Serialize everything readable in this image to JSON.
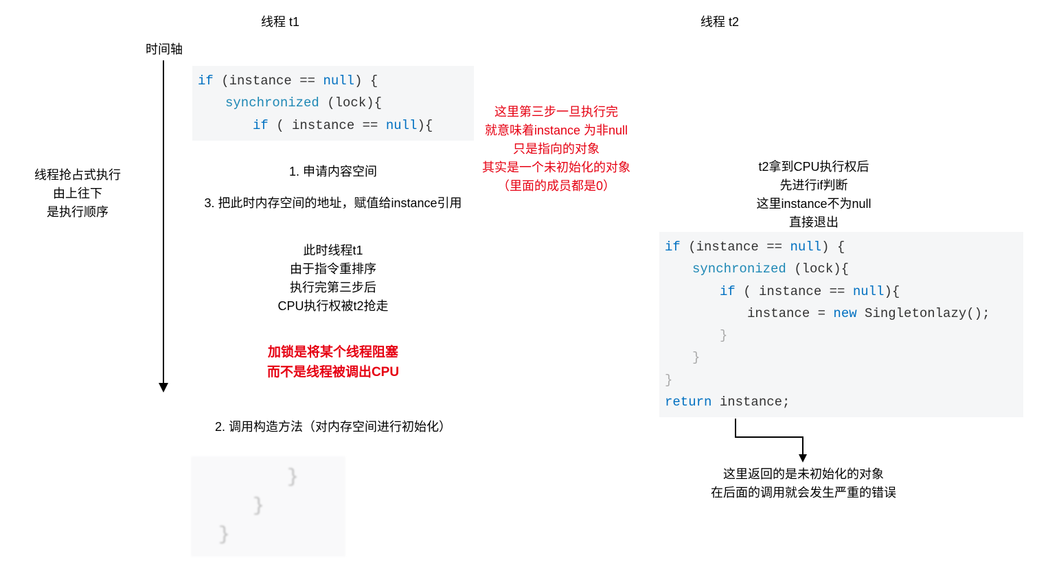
{
  "headers": {
    "t1": "线程 t1",
    "t2": "线程 t2",
    "timeline": "时间轴"
  },
  "leftNote": {
    "l1": "线程抢占式执行",
    "l2": "由上往下",
    "l3": "是执行顺序"
  },
  "code1": {
    "line1_if": "if",
    "line1_rest": " (instance == ",
    "line1_null": "null",
    "line1_end": ") {",
    "line2_sync": "synchronized",
    "line2_rest": " (lock){",
    "line3_if": "if",
    "line3_rest": " ( instance == ",
    "line3_null": "null",
    "line3_end": "){"
  },
  "steps": {
    "s1": "1. 申请内容空间",
    "s3": "3. 把此时内存空间的地址，赋值给instance引用",
    "s2": "2. 调用构造方法（对内存空间进行初始化）"
  },
  "t1mid": {
    "l1": "此时线程t1",
    "l2": "由于指令重排序",
    "l3": "执行完第三步后",
    "l4": "CPU执行权被t2抢走"
  },
  "t1bold": {
    "l1": "加锁是将某个线程阻塞",
    "l2": "而不是线程被调出CPU"
  },
  "redNote": {
    "l1": "这里第三步一旦执行完",
    "l2": "就意味着instance 为非null",
    "l3": "只是指向的对象",
    "l4": "其实是一个未初始化的对象",
    "l5": "（里面的成员都是0）"
  },
  "t2top": {
    "l1": "t2拿到CPU执行权后",
    "l2": "先进行if判断",
    "l3": "这里instance不为null",
    "l4": "直接退出"
  },
  "code2": {
    "line1_if": "if",
    "line1_rest": " (instance == ",
    "line1_null": "null",
    "line1_end": ") {",
    "line2_sync": "synchronized",
    "line2_rest": " (lock){",
    "line3_if": "if",
    "line3_rest": " ( instance == ",
    "line3_null": "null",
    "line3_end": "){",
    "line4_inst": "instance = ",
    "line4_new": "new",
    "line4_rest": " Singletonlazy();",
    "line5": "}",
    "line6": "}",
    "line7": "}",
    "line8_return": "return",
    "line8_rest": " instance;"
  },
  "t2bottom": {
    "l1": "这里返回的是未初始化的对象",
    "l2": "在后面的调用就会发生严重的错误"
  },
  "braces": {
    "b1": "}",
    "b2": "}",
    "b3": "}"
  }
}
